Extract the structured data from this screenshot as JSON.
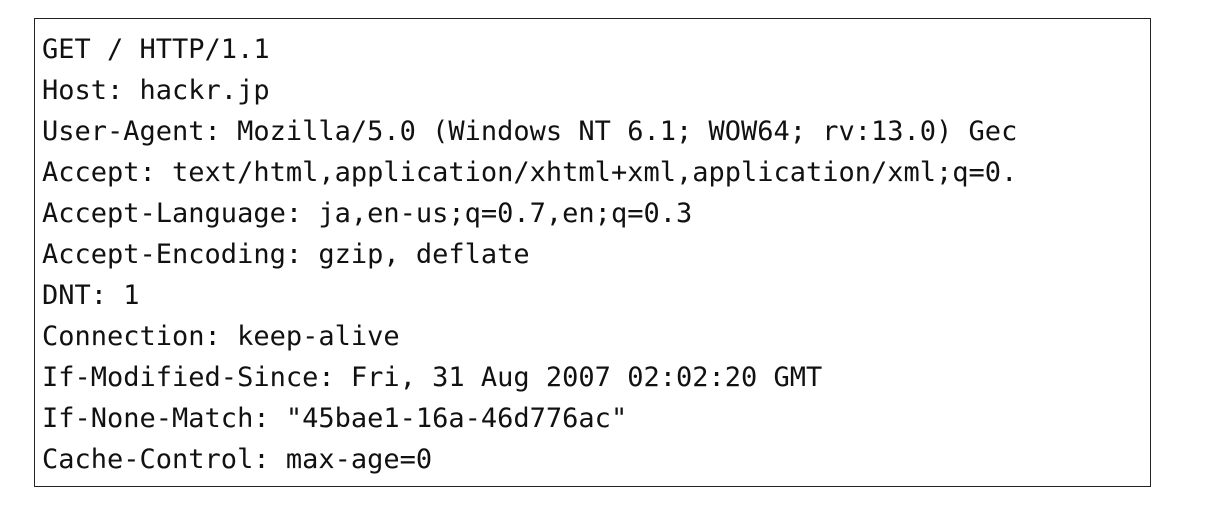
{
  "request": {
    "lines": [
      "GET / HTTP/1.1",
      "Host: hackr.jp",
      "User-Agent: Mozilla/5.0 (Windows NT 6.1; WOW64; rv:13.0) Gec",
      "Accept: text/html,application/xhtml+xml,application/xml;q=0.",
      "Accept-Language: ja,en-us;q=0.7,en;q=0.3",
      "Accept-Encoding: gzip, deflate",
      "DNT: 1",
      "Connection: keep-alive",
      "If-Modified-Since: Fri, 31 Aug 2007 02:02:20 GMT",
      "If-None-Match: \"45bae1-16a-46d776ac\"",
      "Cache-Control: max-age=0"
    ]
  }
}
